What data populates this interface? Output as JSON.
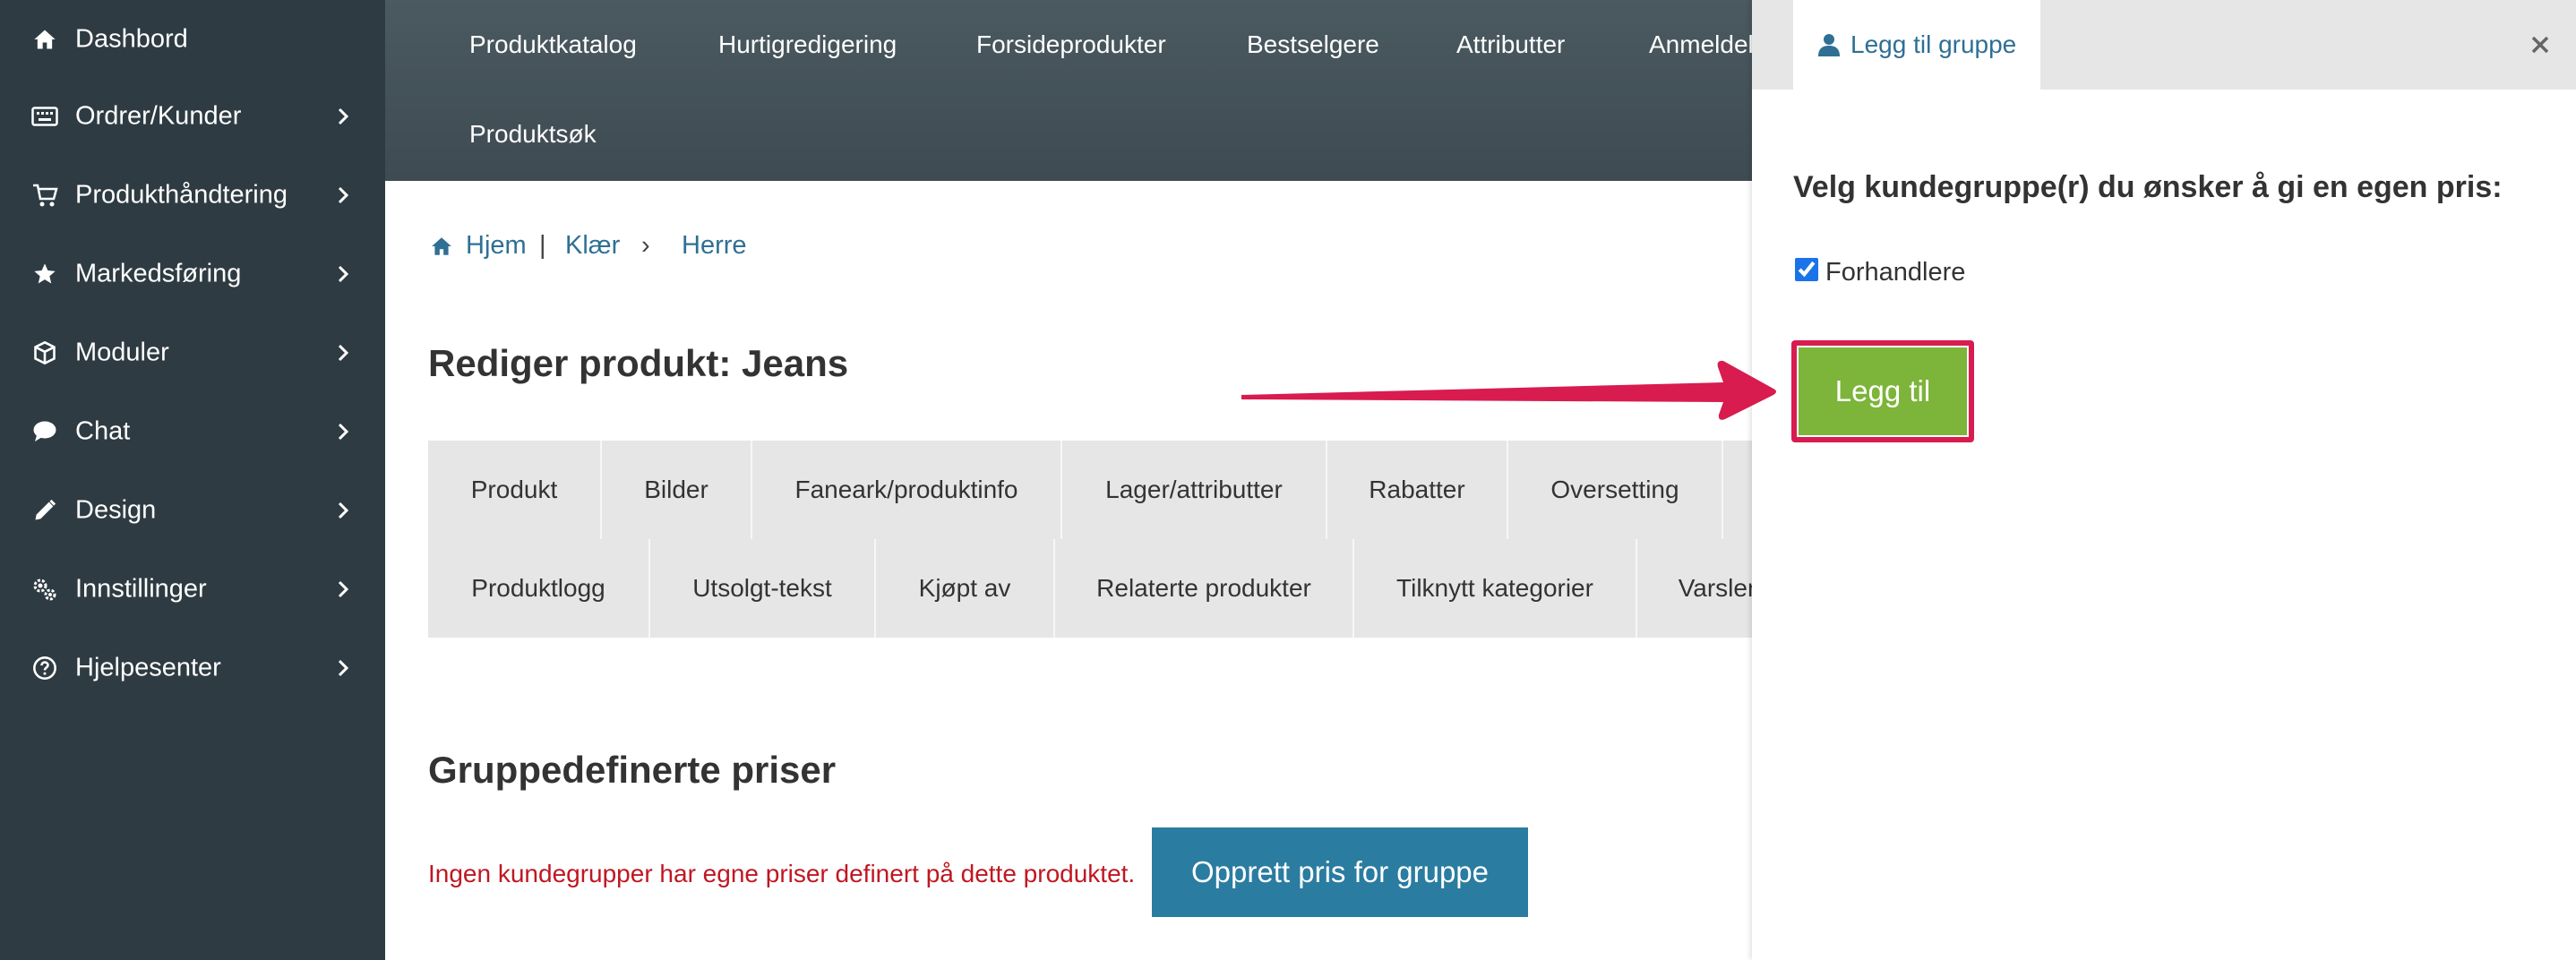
{
  "sidebar": {
    "items": [
      {
        "label": "Dashbord",
        "icon": "home-icon"
      },
      {
        "label": "Ordrer/Kunder",
        "icon": "keyboard-icon"
      },
      {
        "label": "Produkthåndtering",
        "icon": "cart-icon"
      },
      {
        "label": "Markedsføring",
        "icon": "star-icon"
      },
      {
        "label": "Moduler",
        "icon": "cube-icon"
      },
      {
        "label": "Chat",
        "icon": "chat-bubble-icon"
      },
      {
        "label": "Design",
        "icon": "pencil-icon"
      },
      {
        "label": "Innstillinger",
        "icon": "gears-icon"
      },
      {
        "label": "Hjelpesenter",
        "icon": "help-circle-icon"
      }
    ]
  },
  "topnav": {
    "links": [
      "Produktkatalog",
      "Hurtigredigering",
      "Forsideprodukter",
      "Bestselgere",
      "Attributter",
      "Anmeldelser",
      "Produktsøk"
    ]
  },
  "breadcrumb": {
    "home": "Hjem",
    "separator": "|",
    "category": "Klær",
    "chevron": "›",
    "current": "Herre"
  },
  "page_title": "Rediger produkt: Jeans",
  "tabs": {
    "row1": [
      "Produkt",
      "Bilder",
      "Faneark/produktinfo",
      "Lager/attributter",
      "Rabatter",
      "Oversetting"
    ],
    "row2": [
      "Produktlogg",
      "Utsolgt-tekst",
      "Kjøpt av",
      "Relaterte produkter",
      "Tilknytt kategorier",
      "Varsler"
    ]
  },
  "group_prices": {
    "title": "Gruppedefinerte priser",
    "empty_message": "Ingen kundegrupper har egne priser definert på dette produktet.",
    "create_button": "Opprett pris for gruppe"
  },
  "panel": {
    "tab_label": "Legg til gruppe",
    "heading": "Velg kundegruppe(r) du ønsker å gi en egen pris:",
    "groups": [
      {
        "label": "Forhandlere",
        "checked": true
      }
    ],
    "add_button": "Legg til"
  },
  "colors": {
    "sidebar_bg": "#2e3b42",
    "link": "#2f6f94",
    "error_text": "#c01722",
    "primary_button": "#2a7ca0",
    "add_button": "#7db43a",
    "highlight": "#d81c4f"
  }
}
